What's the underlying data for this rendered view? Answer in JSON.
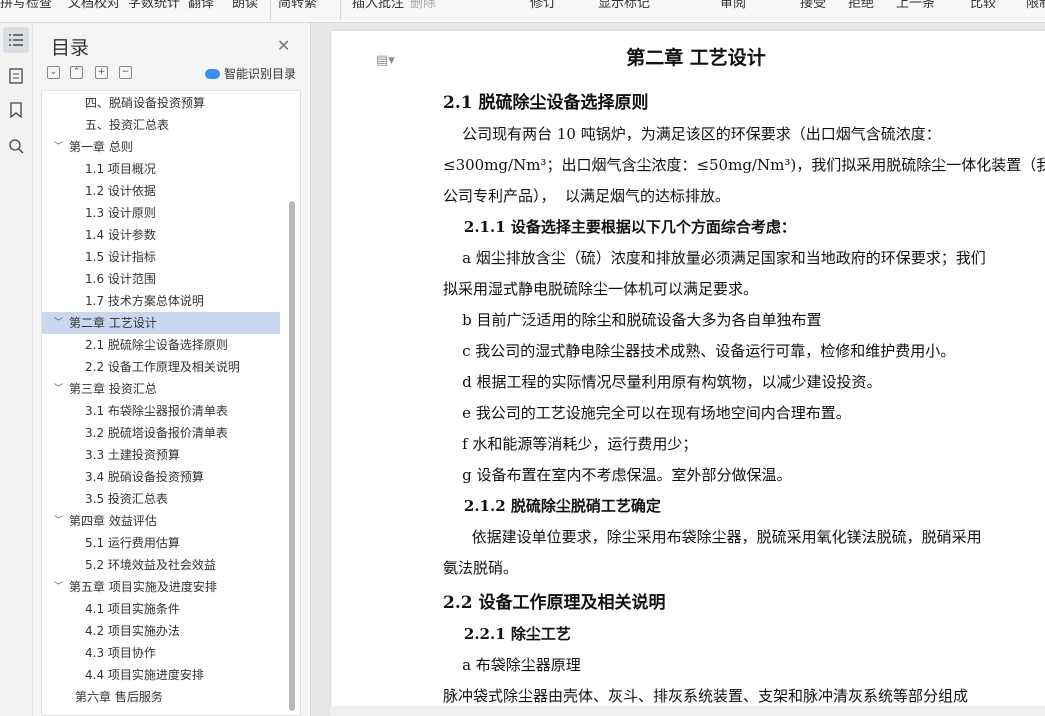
{
  "toolbar": {
    "items": [
      "拼写检查",
      "文档校对",
      "字数统计",
      "翻译",
      "朗读",
      "简转繁",
      "插入批注",
      "删除",
      "修订",
      "显示标记",
      "审阅",
      "接受",
      "拒绝",
      "上一条",
      "比较",
      "限制"
    ]
  },
  "rail": {
    "icons": [
      "toc-icon",
      "outline-icon",
      "bookmark-icon",
      "search-doc-icon"
    ]
  },
  "toc": {
    "title": "目录",
    "smart_label": "智能识别目录",
    "items": [
      {
        "label": "四、脱硝设备投资预算",
        "level": 2
      },
      {
        "label": "五、投资汇总表",
        "level": 2
      },
      {
        "label": "第一章   总则",
        "level": 1,
        "expanded": true
      },
      {
        "label": "1.1 项目概况",
        "level": 2
      },
      {
        "label": "1.2  设计依据",
        "level": 2
      },
      {
        "label": "1.3  设计原则",
        "level": 2
      },
      {
        "label": "1.4  设计参数",
        "level": 2
      },
      {
        "label": "1.5  设计指标",
        "level": 2
      },
      {
        "label": "1.6  设计范围",
        "level": 2
      },
      {
        "label": "1.7  技术方案总体说明",
        "level": 2
      },
      {
        "label": "第二章    工艺设计",
        "level": 1,
        "expanded": true,
        "selected": true
      },
      {
        "label": "2.1  脱硫除尘设备选择原则",
        "level": 2
      },
      {
        "label": "2.2 设备工作原理及相关说明",
        "level": 2
      },
      {
        "label": "第三章  投资汇总",
        "level": 1,
        "expanded": true
      },
      {
        "label": "3.1 布袋除尘器报价清单表",
        "level": 2
      },
      {
        "label": "3.2 脱硫塔设备报价清单表",
        "level": 2
      },
      {
        "label": "3.3 土建投资预算",
        "level": 2
      },
      {
        "label": "3.4 脱硝设备投资预算",
        "level": 2
      },
      {
        "label": "3.5 投资汇总表",
        "level": 2
      },
      {
        "label": "第四章  效益评估",
        "level": 1,
        "expanded": true
      },
      {
        "label": "5.1 运行费用估算",
        "level": 2
      },
      {
        "label": "5.2 环境效益及社会效益",
        "level": 2
      },
      {
        "label": "第五章  项目实施及进度安排",
        "level": 1,
        "expanded": true
      },
      {
        "label": "4.1 项目实施条件",
        "level": 2
      },
      {
        "label": "4.2 项目实施办法",
        "level": 2
      },
      {
        "label": "4.3 项目协作",
        "level": 2
      },
      {
        "label": "4.4 项目实施进度安排",
        "level": 2
      },
      {
        "label": "第六章    售后服务",
        "level": 1,
        "expanded": false
      }
    ]
  },
  "document": {
    "chapter_title": "第二章    工艺设计",
    "lines": [
      {
        "text": "2.1 脱硫除尘设备选择原则",
        "style": "sec"
      },
      {
        "text": "    公司现有两台 10 吨锅炉，为满足该区的环保要求（出口烟气含硫浓度：",
        "style": "normal"
      },
      {
        "text": "≤300mg/Nm³；出口烟气含尘浓度：≤50mg/Nm³)，我们拟采用脱硫除尘一体化装置（我",
        "style": "normal"
      },
      {
        "text": "公司专利产品），  以满足烟气的达标排放。",
        "style": "normal"
      },
      {
        "text": "    2.1.1 设备选择主要根据以下几个方面综合考虑：",
        "style": "bold"
      },
      {
        "text": "    a 烟尘排放含尘（硫）浓度和排放量必须满足国家和当地政府的环保要求；我们",
        "style": "normal"
      },
      {
        "text": "拟采用湿式静电脱硫除尘一体机可以满足要求。",
        "style": "normal"
      },
      {
        "text": "    b 目前广泛适用的除尘和脱硫设备大多为各自单独布置",
        "style": "normal"
      },
      {
        "text": "    c 我公司的湿式静电除尘器技术成熟、设备运行可靠，检修和维护费用小。",
        "style": "normal"
      },
      {
        "text": "    d 根据工程的实际情况尽量利用原有构筑物，以减少建设投资。",
        "style": "normal"
      },
      {
        "text": "    e 我公司的工艺设施完全可以在现有场地空间内合理布置。",
        "style": "normal"
      },
      {
        "text": "    f 水和能源等消耗少，运行费用少；",
        "style": "normal"
      },
      {
        "text": "    g 设备布置在室内不考虑保温。室外部分做保温。",
        "style": "normal"
      },
      {
        "text": "    2.1.2 脱硫除尘脱硝工艺确定",
        "style": "bold"
      },
      {
        "text": "      依据建设单位要求，除尘采用布袋除尘器，脱硫采用氧化镁法脱硫，脱硝采用",
        "style": "normal"
      },
      {
        "text": "氨法脱硝。",
        "style": "normal"
      },
      {
        "text": "2.2 设备工作原理及相关说明",
        "style": "sec"
      },
      {
        "text": "    2.2.1 除尘工艺",
        "style": "bold"
      },
      {
        "text": "    a 布袋除尘器原理",
        "style": "normal"
      },
      {
        "text": "脉冲袋式除尘器由壳体、灰斗、排灰系统装置、支架和脉冲清灰系统等部分组成",
        "style": "normal"
      }
    ]
  }
}
